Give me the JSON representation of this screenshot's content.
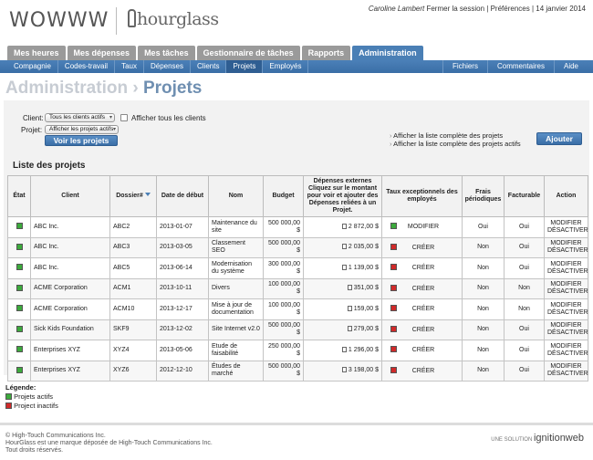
{
  "header": {
    "logo_text": "WOWWW",
    "product_logo": "hourglass",
    "user_name": "Caroline Lambert",
    "logout": "Fermer la session",
    "prefs": "Préférences",
    "date": "14 janvier 2014",
    "sep": "|"
  },
  "tabs": [
    "Mes heures",
    "Mes dépenses",
    "Mes tâches",
    "Gestionnaire de tâches",
    "Rapports",
    "Administration"
  ],
  "subnav": {
    "items": [
      "Compagnie",
      "Codes-travail",
      "Taux",
      "Dépenses",
      "Clients",
      "Projets",
      "Employés"
    ],
    "right": [
      "Fichiers",
      "Commentaires",
      "Aide"
    ]
  },
  "title": {
    "parent": "Administration",
    "sep": "›",
    "current": "Projets"
  },
  "filters": {
    "client_label": "Client:",
    "client_value": "Tous les clients actifs",
    "project_label": "Projet:",
    "project_value": "Afficher les projets actifs",
    "show_all_clients": "Afficher tous les clients",
    "view_button": "Voir les projets",
    "link1": "Afficher la liste complète des projets",
    "link2": "Afficher la liste complète des projets actifs",
    "add_button": "Ajouter"
  },
  "list_title": "Liste des projets",
  "columns": {
    "etat": "État",
    "client": "Client",
    "dossier": "Dossier#",
    "date": "Date de début",
    "nom": "Nom",
    "budget": "Budget",
    "depenses": "Dépenses externes Cliquez sur le montant pour voir et ajouter des Dépenses reliées à un Projet.",
    "taux": "Taux exceptionnels des employés",
    "frais": "Frais périodiques",
    "facturable": "Facturable",
    "action": "Action"
  },
  "rows": [
    {
      "client": "ABC Inc.",
      "dossier": "ABC2",
      "date": "2013-01-07",
      "nom": "Maintenance du site",
      "budget": "500 000,00 $",
      "dep": "2 872,00 $",
      "taux_color": "green",
      "taux": "MODIFIER",
      "frais": "Oui",
      "fact": "Oui"
    },
    {
      "client": "ABC Inc.",
      "dossier": "ABC3",
      "date": "2013-03-05",
      "nom": "Classement SEO",
      "budget": "500 000,00 $",
      "dep": "2 035,00 $",
      "taux_color": "red",
      "taux": "CRÉER",
      "frais": "Non",
      "fact": "Oui"
    },
    {
      "client": "ABC Inc.",
      "dossier": "ABC5",
      "date": "2013-06-14",
      "nom": "Modernisation du système",
      "budget": "300 000,00 $",
      "dep": "1 139,00 $",
      "taux_color": "red",
      "taux": "CRÉER",
      "frais": "Non",
      "fact": "Oui"
    },
    {
      "client": "ACME Corporation",
      "dossier": "ACM1",
      "date": "2013-10-11",
      "nom": "Divers",
      "budget": "100 000,00 $",
      "dep": "351,00 $",
      "taux_color": "red",
      "taux": "CRÉER",
      "frais": "Non",
      "fact": "Non"
    },
    {
      "client": "ACME Corporation",
      "dossier": "ACM10",
      "date": "2013-12-17",
      "nom": "Mise à jour de documentation",
      "budget": "100 000,00 $",
      "dep": "159,00 $",
      "taux_color": "red",
      "taux": "CRÉER",
      "frais": "Non",
      "fact": "Non"
    },
    {
      "client": "Sick Kids Foundation",
      "dossier": "SKF9",
      "date": "2013-12-02",
      "nom": "Site Internet v2.0",
      "budget": "500 000,00 $",
      "dep": "279,00 $",
      "taux_color": "red",
      "taux": "CRÉER",
      "frais": "Non",
      "fact": "Oui"
    },
    {
      "client": "Enterprises XYZ",
      "dossier": "XYZ4",
      "date": "2013-05-06",
      "nom": "Etude de faisabilité",
      "budget": "250 000,00 $",
      "dep": "1 296,00 $",
      "taux_color": "red",
      "taux": "CRÉER",
      "frais": "Non",
      "fact": "Oui"
    },
    {
      "client": "Enterprises XYZ",
      "dossier": "XYZ6",
      "date": "2012-12-10",
      "nom": "Études de marché",
      "budget": "500 000,00 $",
      "dep": "3 198,00 $",
      "taux_color": "red",
      "taux": "CRÉER",
      "frais": "Non",
      "fact": "Oui"
    }
  ],
  "row_actions": {
    "edit": "MODIFIER",
    "deactivate": "DÉSACTIVER"
  },
  "legend": {
    "title": "Légende:",
    "active": "Projets actifs",
    "inactive": "Project inactifs"
  },
  "footer": {
    "line1": "© High-Touch Communications Inc.",
    "line2": "HourGlass est une marque déposée de High-Touch Communications Inc.",
    "line3": "Tout droits réservés.",
    "brand_prefix": "UNE SOLUTION",
    "brand": "ignitionweb"
  },
  "colors": {
    "accent": "#4a7fb5",
    "active_status": "#3caa3c",
    "inactive_status": "#d02a2a",
    "tab_inactive": "#9a9a9a"
  }
}
